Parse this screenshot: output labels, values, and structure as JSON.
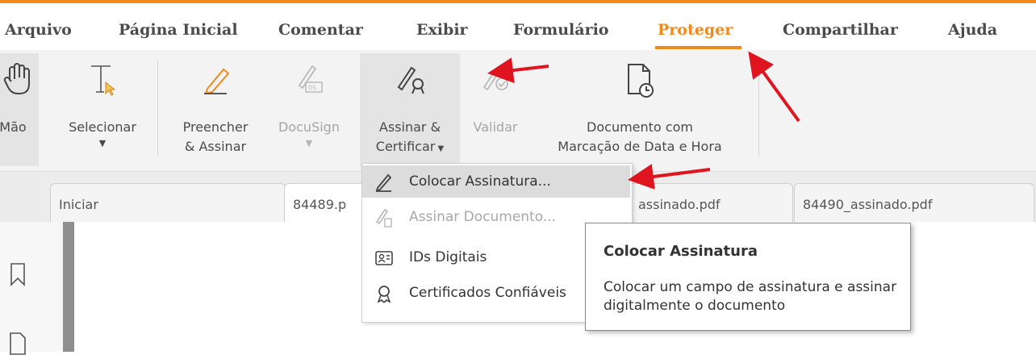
{
  "colors": {
    "accent": "#f08a1c",
    "arrow": "#e0141e"
  },
  "menu": {
    "items": [
      "Arquivo",
      "Página Inicial",
      "Comentar",
      "Exibir",
      "Formulário",
      "Proteger",
      "Compartilhar",
      "Ajuda"
    ],
    "active": "Proteger"
  },
  "ribbon": {
    "hand": {
      "label": "Mão",
      "icon": "hand-icon"
    },
    "select": {
      "label": "Selecionar",
      "icon": "text-cursor-icon"
    },
    "fill_sign": {
      "label_line1": "Preencher",
      "label_line2": "& Assinar",
      "icon": "pen-icon"
    },
    "docusign": {
      "label": "DocuSign",
      "icon": "docusign-pen-icon"
    },
    "sign_certify": {
      "label_line1": "Assinar &",
      "label_line2": "Certificar",
      "icon": "certificate-pen-icon"
    },
    "validate": {
      "label": "Validar",
      "icon": "validate-pen-icon"
    },
    "timestamp": {
      "label_line1": "Documento com",
      "label_line2": "Marcação de Data e Hora",
      "icon": "document-clock-icon"
    }
  },
  "tabs": [
    "Iniciar",
    "84489.p",
    "assinado.pdf",
    "84490_assinado.pdf"
  ],
  "dropdown": {
    "items": [
      {
        "label": "Colocar Assinatura...",
        "icon": "pen-icon",
        "state": "highlighted"
      },
      {
        "label": "Assinar Documento...",
        "icon": "document-pen-icon",
        "state": "disabled"
      },
      {
        "label": "IDs Digitais",
        "icon": "id-card-icon",
        "state": "normal"
      },
      {
        "label": "Certificados Confiáveis",
        "icon": "certificate-icon",
        "state": "normal"
      }
    ]
  },
  "tooltip": {
    "title": "Colocar Assinatura",
    "description": "Colocar um campo de assinatura e assinar digitalmente o documento"
  }
}
